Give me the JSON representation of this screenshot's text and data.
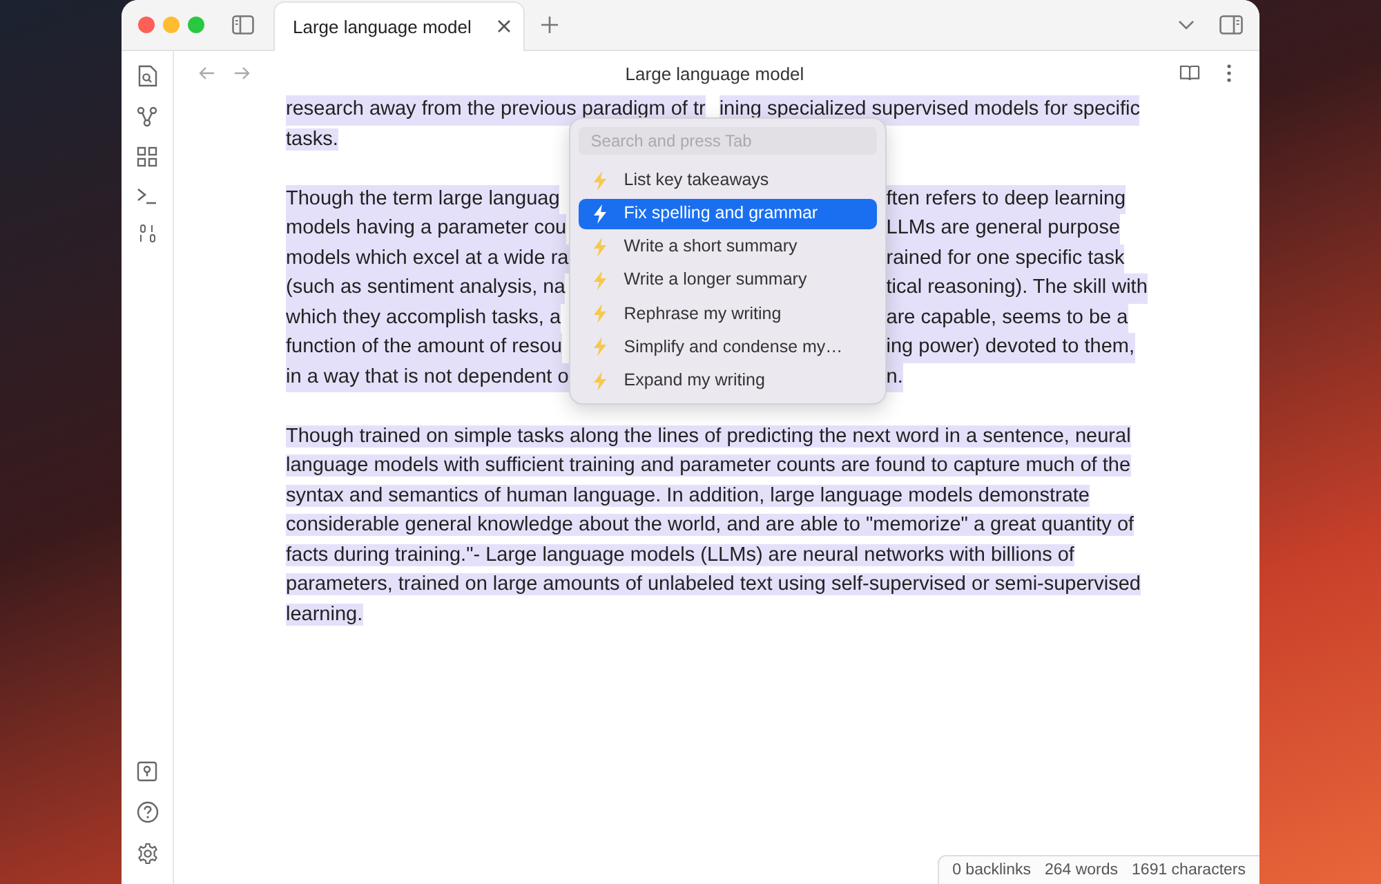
{
  "window": {
    "tabs": [
      {
        "label": "Large language model",
        "selected": true
      }
    ]
  },
  "note": {
    "title": "Large language model",
    "intro": {
      "left": "research away from the previous paradigm of tr",
      "right": "ining specialized supervised models for specific",
      "last": "tasks."
    },
    "covered_lines": [
      {
        "left": "Though the term large languag",
        "right": "ften refers to deep learning"
      },
      {
        "left": "models having a parameter cou",
        "right": "LLMs are general purpose"
      },
      {
        "left": "models which excel at a wide ra",
        "right": "rained for one specific task"
      },
      {
        "left": "(such as sentiment analysis, na",
        "right": "tical reasoning). The skill with"
      },
      {
        "left": "which they accomplish tasks, a",
        "right": "are capable, seems to be a"
      },
      {
        "left": "function of the amount of resou",
        "right": "ing power) devoted to them,"
      },
      {
        "left": "in a way that is not dependent o",
        "right": "n."
      }
    ],
    "paragraph": "Though trained on simple tasks along the lines of predicting the next word in a sentence, neural language models with sufficient training and parameter counts are found to capture much of the syntax and semantics of human language. In addition, large language models demonstrate considerable general knowledge about the world, and are able to \"memorize\" a great quantity of facts during training.\"- Large language models (LLMs) are neural networks with billions of parameters, trained on large amounts of unlabeled text using self-supervised or semi-supervised learning."
  },
  "ai_menu": {
    "placeholder": "Search and press Tab",
    "items": [
      {
        "label": "List key takeaways",
        "selected": false
      },
      {
        "label": "Fix spelling and grammar",
        "selected": true
      },
      {
        "label": "Write a short summary",
        "selected": false
      },
      {
        "label": "Write a longer summary",
        "selected": false
      },
      {
        "label": "Rephrase my writing",
        "selected": false
      },
      {
        "label": "Simplify and condense my…",
        "selected": false
      },
      {
        "label": "Expand my writing",
        "selected": false
      }
    ]
  },
  "status_bar": [
    "0 backlinks",
    "264 words",
    "1691 characters"
  ]
}
